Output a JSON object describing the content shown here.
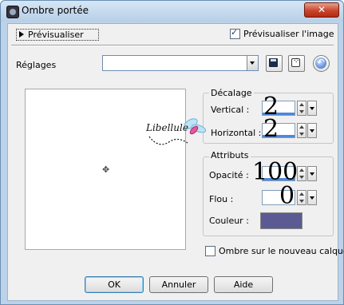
{
  "window": {
    "title": "Ombre portée",
    "close_label": "✕"
  },
  "preview": {
    "toggle_label": "Prévisualiser",
    "image_checkbox_label": "Prévisualiser l'image",
    "image_checked": true
  },
  "settings": {
    "label": "Réglages",
    "value": ""
  },
  "offset": {
    "title": "Décalage",
    "vertical_label": "Vertical :",
    "vertical_value": "2",
    "horizontal_label": "Horizontal :",
    "horizontal_value": "2"
  },
  "attributes": {
    "title": "Attributs",
    "opacity_label": "Opacité :",
    "opacity_value": "100",
    "blur_label": "Flou :",
    "blur_value": "0",
    "color_label": "Couleur :",
    "color_value": "#5b5a93"
  },
  "new_layer": {
    "label": "Ombre sur le nouveau calque",
    "checked": false
  },
  "buttons": {
    "ok": "OK",
    "cancel": "Annuler",
    "help": "Aide"
  },
  "watermark": {
    "text": "Libellule"
  }
}
